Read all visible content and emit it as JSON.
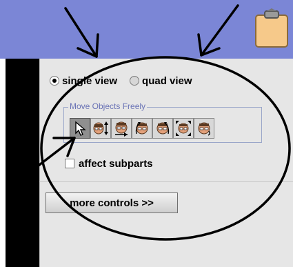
{
  "view_mode": {
    "single_label": "single view",
    "quad_label": "quad view",
    "selected": "single view"
  },
  "move_group": {
    "title": "Move Objects Freely",
    "tools": [
      {
        "icon": "arrow-pointer-icon",
        "selected": true
      },
      {
        "icon": "face-vertical-arrows-icon",
        "selected": false
      },
      {
        "icon": "face-bottom-arrow-icon",
        "selected": false
      },
      {
        "icon": "face-rotate-left-icon",
        "selected": false
      },
      {
        "icon": "face-rotate-right-icon",
        "selected": false
      },
      {
        "icon": "face-expand-icon",
        "selected": false
      },
      {
        "icon": "face-tilt-icon",
        "selected": false
      }
    ]
  },
  "affect_subparts": {
    "label": "affect subparts",
    "checked": false
  },
  "more_controls": {
    "label": "more controls >>"
  },
  "colors": {
    "banner": "#7b86d6",
    "panel": "#e6e6e6",
    "group_title": "#6b74b6"
  }
}
